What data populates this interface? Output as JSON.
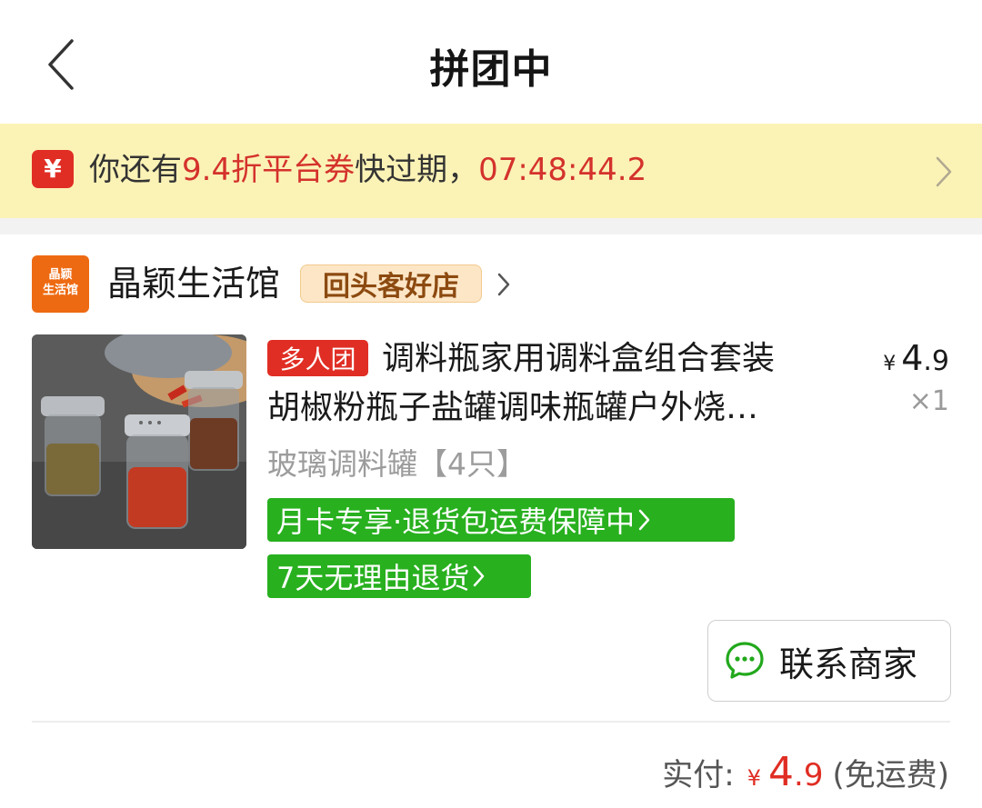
{
  "header": {
    "title": "拼团中",
    "back_icon": "chevron-left-icon"
  },
  "coupon": {
    "icon_glyph": "¥",
    "text_prefix": "你还有",
    "text_highlight": "9.4折平台券",
    "text_suffix": "快过期，",
    "countdown": "07:48:44.2",
    "accent_color": "#d4322c"
  },
  "shop": {
    "logo_text_line1": "晶颖",
    "logo_text_line2": "生活馆",
    "name": "晶颖生活馆",
    "badge": "回头客好店"
  },
  "product": {
    "tag": "多人团",
    "title_line1": "调料瓶家用调料盒组合套装",
    "title_line2": "胡椒粉瓶子盐罐调味瓶罐户外烧…",
    "price_symbol": "¥",
    "price_int": "4",
    "price_dec": ".9",
    "quantity": "×1",
    "spec": "玻璃调料罐【4只】",
    "service_tags": [
      "月卡专享·退货包运费保障中",
      "7天无理由退货"
    ]
  },
  "contact": {
    "label": "联系商家",
    "icon": "chat-bubble-icon"
  },
  "total": {
    "label": "实付:",
    "symbol": "¥",
    "amount_int": "4",
    "amount_dec": ".9",
    "note": "(免运费)"
  },
  "colors": {
    "red": "#e02e24",
    "green": "#28b01f",
    "coupon_bg": "#fbf2b6",
    "shop_logo": "#ee6a12"
  }
}
